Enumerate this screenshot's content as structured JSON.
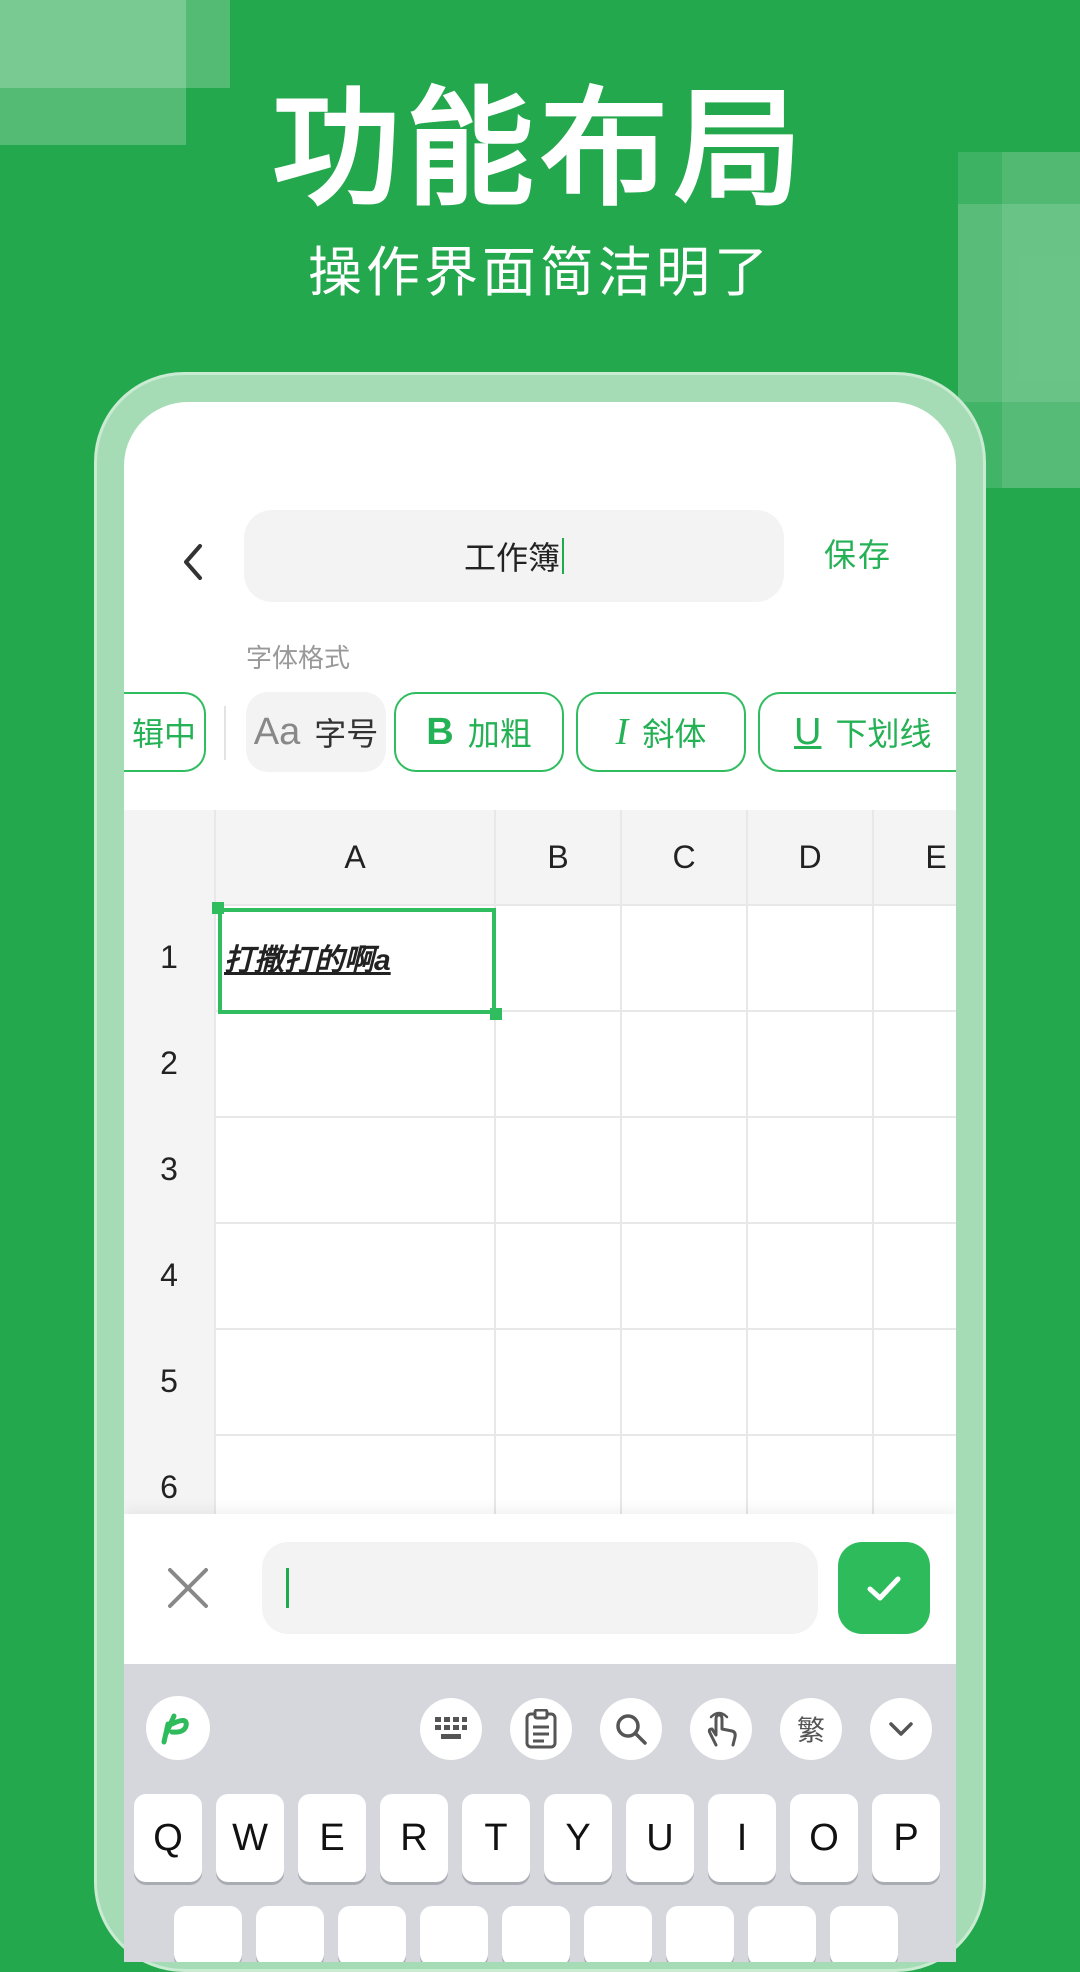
{
  "hero": {
    "title": "功能布局",
    "subtitle": "操作界面简洁明了"
  },
  "header": {
    "title_value": "工作簿",
    "save_label": "保存"
  },
  "format": {
    "section_label": "字体格式",
    "chips": [
      {
        "label": "辑中"
      },
      {
        "icon": "Aa",
        "label": "字号"
      },
      {
        "icon": "B",
        "label": "加粗"
      },
      {
        "icon": "I",
        "label": "斜体"
      },
      {
        "icon": "U",
        "label": "下划线"
      }
    ]
  },
  "sheet": {
    "columns": [
      "A",
      "B",
      "C",
      "D",
      "E"
    ],
    "rows": [
      "1",
      "2",
      "3",
      "4",
      "5",
      "6"
    ],
    "cell_a1": "打撒打的啊a"
  },
  "input_bar": {
    "value": "",
    "placeholder": ""
  },
  "keyboard": {
    "tools": [
      "keyboard-icon",
      "clipboard-icon",
      "search-icon",
      "gesture-icon",
      "繁",
      "chevron-down-icon"
    ],
    "traditional_label": "繁",
    "row1": [
      "Q",
      "W",
      "E",
      "R",
      "T",
      "Y",
      "U",
      "I",
      "O",
      "P"
    ]
  },
  "colors": {
    "brand": "#24a84e",
    "accent": "#2dbb5c",
    "frame": "#a6dcb5"
  }
}
